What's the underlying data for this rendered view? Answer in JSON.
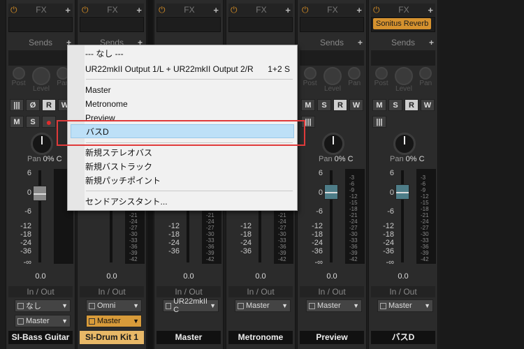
{
  "strips": [
    {
      "name": "SI-Bass Guitar",
      "highlight": false,
      "input": "なし",
      "output": "Master",
      "pan": "0% C",
      "volume": "0.0",
      "fx": ""
    },
    {
      "name": "SI-Drum Kit 1",
      "highlight": true,
      "input": "Omni",
      "output": "Master",
      "pan": "",
      "volume": "0.0",
      "fx": ""
    },
    {
      "name": "Master",
      "highlight": false,
      "input": "UR22mkII C",
      "output": "",
      "pan": "",
      "volume": "0.0",
      "fx": ""
    },
    {
      "name": "Metronome",
      "highlight": false,
      "input": "Master",
      "output": "",
      "pan": "",
      "volume": "0.0",
      "fx": ""
    },
    {
      "name": "Preview",
      "highlight": false,
      "input": "Master",
      "output": "",
      "pan": "0% C",
      "volume": "0.0",
      "fx": ""
    },
    {
      "name": "バスD",
      "highlight": false,
      "input": "Master",
      "output": "",
      "pan": "0% C",
      "volume": "0.0",
      "fx": "Sonitus Reverb"
    }
  ],
  "labels": {
    "fx": "FX",
    "sends": "Sends",
    "in_out": "In / Out",
    "pan": "Pan",
    "post": "Post",
    "level": "Level",
    "pan_knob": "Pan"
  },
  "buttons": {
    "m": "M",
    "s": "S",
    "r": "R",
    "w": "W",
    "phase": "Ø"
  },
  "scale": [
    "6",
    "0",
    "-6",
    "-12",
    "-18",
    "-24",
    "-36",
    "-∞"
  ],
  "meter_scale": [
    "-3",
    "-6",
    "-9",
    "-12",
    "-15",
    "-18",
    "-21",
    "-24",
    "-27",
    "-30",
    "-33",
    "-36",
    "-39",
    "-42"
  ],
  "menu": {
    "items": [
      {
        "label": "--- なし ---",
        "shortcut": ""
      },
      {
        "label": "UR22mkII Output 1/L + UR22mkII Output 2/R",
        "shortcut": "1+2 S"
      },
      {
        "label": "Master",
        "shortcut": ""
      },
      {
        "label": "Metronome",
        "shortcut": ""
      },
      {
        "label": "Preview",
        "shortcut": ""
      },
      {
        "label": "バスD",
        "shortcut": ""
      },
      {
        "label": "新規ステレオバス",
        "shortcut": ""
      },
      {
        "label": "新規バストラック",
        "shortcut": ""
      },
      {
        "label": "新規パッチポイント",
        "shortcut": ""
      },
      {
        "label": "センドアシスタント...",
        "shortcut": ""
      }
    ]
  },
  "colors": {
    "accent_orange": "#e8b867",
    "highlight_blue": "#bde0f7",
    "callout_red": "#e03a3a"
  }
}
